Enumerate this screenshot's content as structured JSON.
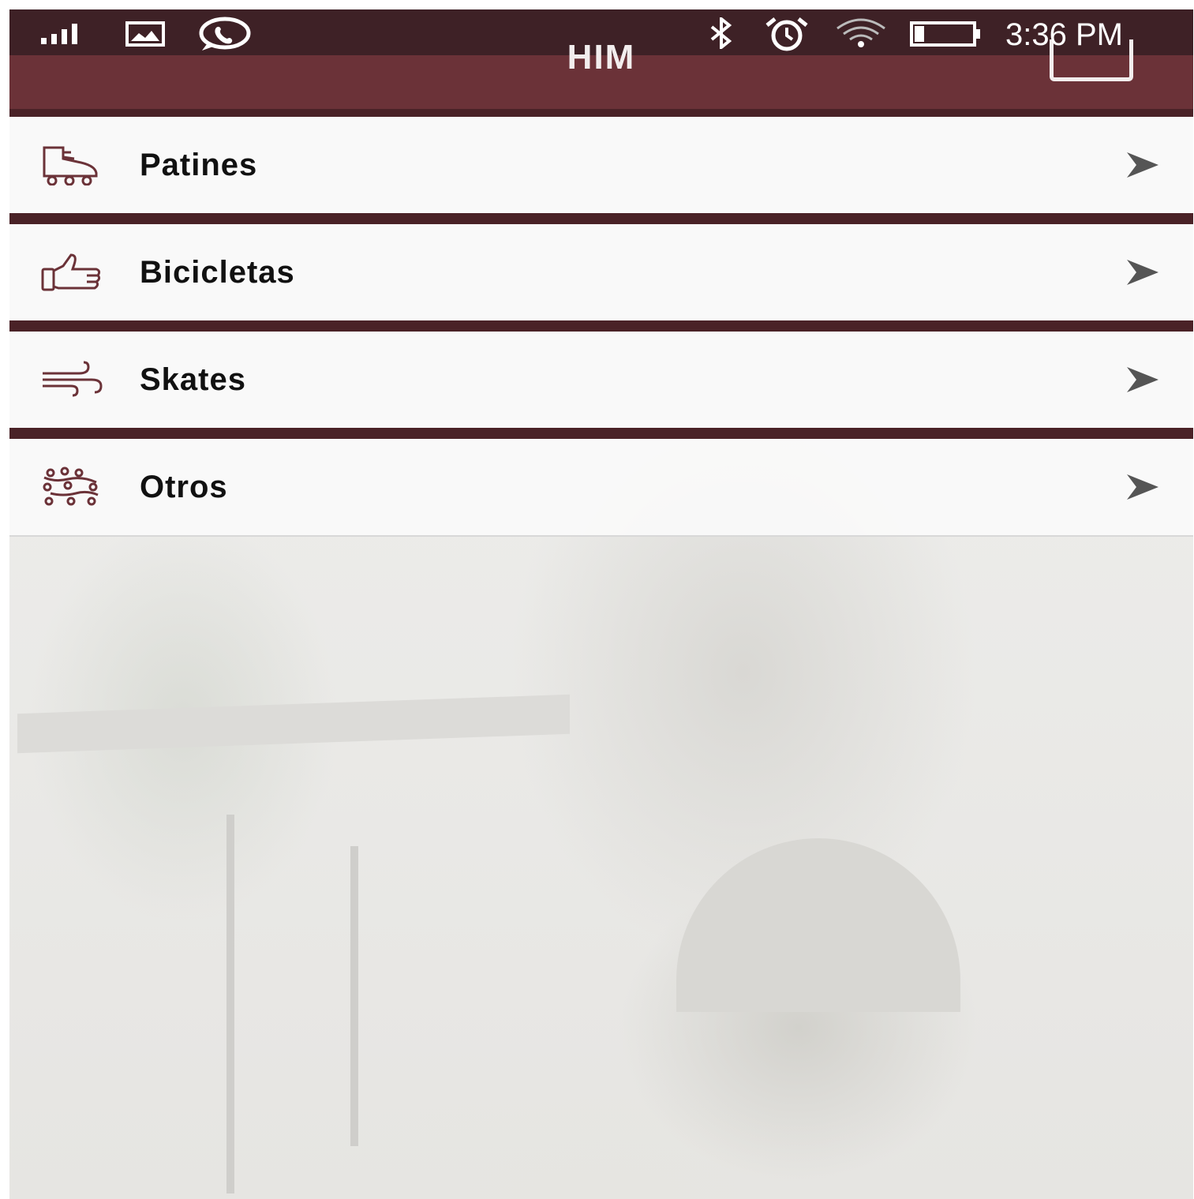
{
  "status_bar": {
    "time": "3:36 PM",
    "icons": [
      "signal-icon",
      "image-icon",
      "whatsapp-icon",
      "bluetooth-icon",
      "alarm-icon",
      "wifi-icon",
      "battery-icon"
    ]
  },
  "app_bar": {
    "title": "HIM",
    "action_icon": "edit-icon"
  },
  "menu": {
    "items": [
      {
        "label": "Patines",
        "icon": "roller-skate-icon"
      },
      {
        "label": "Bicicletas",
        "icon": "thumbs-up-icon"
      },
      {
        "label": "Skates",
        "icon": "wind-icon"
      },
      {
        "label": "Otros",
        "icon": "nodes-icon"
      }
    ],
    "chevron_icon": "chevron-right-icon"
  },
  "colors": {
    "status_bar": "#3e2126",
    "app_bar": "#6b3238",
    "divider": "#4a2227",
    "icon": "#6b3238",
    "chevron": "#555555"
  }
}
